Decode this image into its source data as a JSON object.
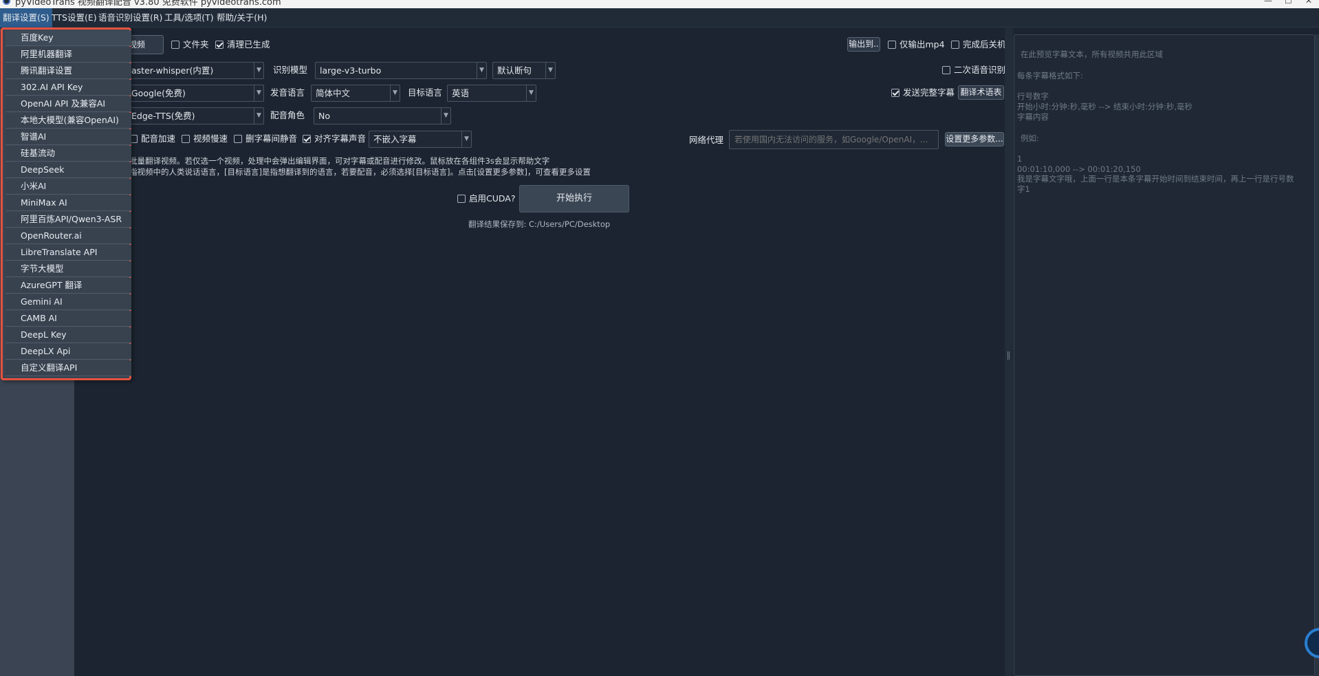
{
  "window": {
    "title": "pyVideoTrans 视频翻译配音 v3.80 免费软件 pyvideotrans.com",
    "controls": {
      "minimize": "—",
      "maximize": "☐",
      "close": "✕"
    }
  },
  "menubar": {
    "items": [
      {
        "label": "翻译设置(S)",
        "active": true
      },
      {
        "label": "TTS设置(E)"
      },
      {
        "label": "语音识别设置(R)"
      },
      {
        "label": "工具/选项(T)"
      },
      {
        "label": "帮助/关于(H)"
      }
    ]
  },
  "dropdown": {
    "items": [
      "百度Key",
      "阿里机器翻译",
      "腾讯翻译设置",
      "302.AI API Key",
      "OpenAI API 及兼容AI",
      "本地大模型(兼容OpenAI)",
      "智谱AI",
      "硅基流动",
      "DeepSeek",
      "小米AI",
      "MiniMax AI",
      "阿里百炼API/Qwen3-ASR",
      "OpenRouter.ai",
      "LibreTranslate API",
      "字节大模型",
      "AzureGPT 翻译",
      "Gemini AI",
      "CAMB AI",
      "DeepL Key",
      "DeepLX Api",
      "自定义翻译API"
    ]
  },
  "main": {
    "select_video_button": "视频",
    "folder_checkbox": {
      "label": "文件夹",
      "checked": false
    },
    "clean_checkbox": {
      "label": "清理已生成",
      "checked": true
    },
    "output_button": "输出到..",
    "only_mp4_checkbox": {
      "label": "仅输出mp4",
      "checked": false
    },
    "shutdown_checkbox": {
      "label": "完成后关机",
      "checked": false
    },
    "asr_engine": "aster-whisper(内置)",
    "asr_model_label": "识别模型",
    "asr_model": "large-v3-turbo",
    "split_mode": "默认断句",
    "second_asr_checkbox": {
      "label": "二次语音识别",
      "checked": false
    },
    "translator": "Google(免费)",
    "source_lang_label": "发音语言",
    "source_lang": "简体中文",
    "target_lang_label": "目标语言",
    "target_lang": "英语",
    "send_full_checkbox": {
      "label": "发送完整字幕",
      "checked": true
    },
    "glossary_button": "翻译术语表",
    "tts_engine": "Edge-TTS(免费)",
    "voice_role_label": "配音角色",
    "voice_role": "No",
    "speedup_checkbox": {
      "label": "配音加速",
      "checked": false
    },
    "slowdown_checkbox": {
      "label": "视频慢速",
      "checked": false
    },
    "remove_silence_checkbox": {
      "label": "删字幕间静音",
      "checked": false
    },
    "align_checkbox": {
      "label": "对齐字幕声音",
      "checked": true
    },
    "embed_subtitle": "不嵌入字幕",
    "proxy_label": "网络代理",
    "proxy_placeholder": "若使用国内无法访问的服务，如Google/OpenAI，...",
    "more_settings_button": "设置更多参数...",
    "help_line1": "批量翻译视频。若仅选一个视频，处理中会弹出编辑界面，可对字幕或配音进行修改。鼠标放在各组件3s会显示帮助文字",
    "help_line2": "指视频中的人类说话语言，[目标语言]是指想翻译到的语言，若要配音，必须选择[目标语言]。点击[设置更多参数]，可查看更多设置",
    "cuda_checkbox": {
      "label": "启用CUDA?",
      "checked": false
    },
    "start_button": "开始执行",
    "save_path": "翻译结果保存到: C:/Users/PC/Desktop"
  },
  "preview": {
    "lines": [
      "在此预览字幕文本，所有视频共用此区域",
      "每条字幕格式如下:",
      "行号数字",
      "开始小时:分钟:秒,毫秒 --> 结束小时:分钟:秒,毫秒",
      "字幕内容",
      "例如:",
      "1",
      "00:01:10,000 --> 00:01:20,150",
      "我是字幕文字哦，上面一行是本条字幕开始时间到结束时间，再上一行是行号数",
      "字1"
    ]
  }
}
